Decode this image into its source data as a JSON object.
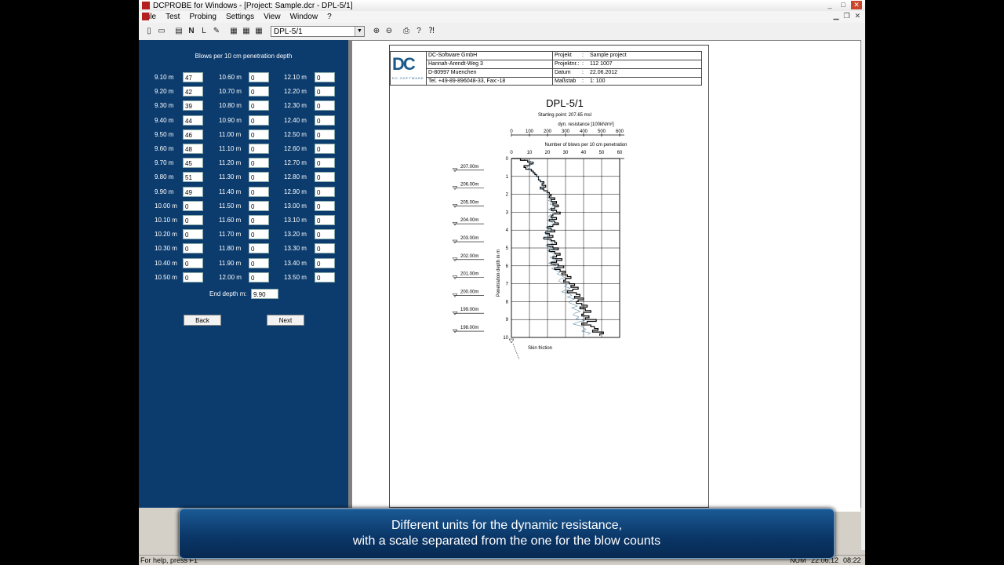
{
  "window": {
    "title": "DCPROBE for Windows - [Project: Sample.dcr - DPL-5/1]",
    "min": "_",
    "max": "□",
    "close": "✕"
  },
  "menu": [
    "File",
    "Test",
    "Probing",
    "Settings",
    "View",
    "Window",
    "?"
  ],
  "toolbar": {
    "combo_value": "DPL-5/1"
  },
  "input_panel": {
    "title": "Blows per 10 cm penetration depth",
    "col1": [
      {
        "depth": "9.10 m",
        "value": "47"
      },
      {
        "depth": "9.20 m",
        "value": "42"
      },
      {
        "depth": "9.30 m",
        "value": "39"
      },
      {
        "depth": "9.40 m",
        "value": "44"
      },
      {
        "depth": "9.50 m",
        "value": "46"
      },
      {
        "depth": "9.60 m",
        "value": "48"
      },
      {
        "depth": "9.70 m",
        "value": "45"
      },
      {
        "depth": "9.80 m",
        "value": "51"
      },
      {
        "depth": "9.90 m",
        "value": "49"
      },
      {
        "depth": "10.00 m",
        "value": "0"
      },
      {
        "depth": "10.10 m",
        "value": "0"
      },
      {
        "depth": "10.20 m",
        "value": "0"
      },
      {
        "depth": "10.30 m",
        "value": "0"
      },
      {
        "depth": "10.40 m",
        "value": "0"
      },
      {
        "depth": "10.50 m",
        "value": "0"
      }
    ],
    "col2": [
      {
        "depth": "10.60 m",
        "value": "0"
      },
      {
        "depth": "10.70 m",
        "value": "0"
      },
      {
        "depth": "10.80 m",
        "value": "0"
      },
      {
        "depth": "10.90 m",
        "value": "0"
      },
      {
        "depth": "11.00 m",
        "value": "0"
      },
      {
        "depth": "11.10 m",
        "value": "0"
      },
      {
        "depth": "11.20 m",
        "value": "0"
      },
      {
        "depth": "11.30 m",
        "value": "0"
      },
      {
        "depth": "11.40 m",
        "value": "0"
      },
      {
        "depth": "11.50 m",
        "value": "0"
      },
      {
        "depth": "11.60 m",
        "value": "0"
      },
      {
        "depth": "11.70 m",
        "value": "0"
      },
      {
        "depth": "11.80 m",
        "value": "0"
      },
      {
        "depth": "11.90 m",
        "value": "0"
      },
      {
        "depth": "12.00 m",
        "value": "0"
      }
    ],
    "col3": [
      {
        "depth": "12.10 m",
        "value": "0"
      },
      {
        "depth": "12.20 m",
        "value": "0"
      },
      {
        "depth": "12.30 m",
        "value": "0"
      },
      {
        "depth": "12.40 m",
        "value": "0"
      },
      {
        "depth": "12.50 m",
        "value": "0"
      },
      {
        "depth": "12.60 m",
        "value": "0"
      },
      {
        "depth": "12.70 m",
        "value": "0"
      },
      {
        "depth": "12.80 m",
        "value": "0"
      },
      {
        "depth": "12.90 m",
        "value": "0"
      },
      {
        "depth": "13.00 m",
        "value": "0"
      },
      {
        "depth": "13.10 m",
        "value": "0"
      },
      {
        "depth": "13.20 m",
        "value": "0"
      },
      {
        "depth": "13.30 m",
        "value": "0"
      },
      {
        "depth": "13.40 m",
        "value": "0"
      },
      {
        "depth": "13.50 m",
        "value": "0"
      }
    ],
    "end_depth_label": "End depth m:",
    "end_depth_value": "9.90",
    "back_label": "Back",
    "next_label": "Next"
  },
  "report_header": {
    "logo_text": "DC",
    "logo_sub": "DC-SOFTWARE",
    "company": "DC-Software GmbH",
    "street": "Hannah-Arendt-Weg 3",
    "city": "D-80997 Muenchen",
    "phone": "Tel. +49-89-896048-33, Fax:-18",
    "labels": [
      "Projekt",
      "Projektnr.:",
      "Datum",
      "Maßstab"
    ],
    "seps": [
      ":",
      ":",
      ":",
      ":"
    ],
    "values": [
      "Sample project",
      "112 1007",
      "22.06.2012",
      "1: 100"
    ]
  },
  "chart_data": {
    "type": "line",
    "title": "DPL-5/1",
    "subtitle": "Starting point: 207.65 msl",
    "x_top_label": "dyn. resistance [100kN/m²]",
    "x_top_ticks": [
      "0",
      "100",
      "200",
      "300",
      "400",
      "500",
      "600"
    ],
    "x_label": "Number of blows per 10 cm penetration",
    "x_ticks": [
      "0",
      "10",
      "20",
      "30",
      "40",
      "50",
      "60"
    ],
    "xlim": [
      0,
      60
    ],
    "ylabel": "Penetration depth in m",
    "y_ticks": [
      "0",
      "1",
      "2",
      "3",
      "4",
      "5",
      "6",
      "7",
      "8",
      "9",
      "10"
    ],
    "ylim": [
      0,
      10
    ],
    "elevation_levels": [
      "207.00m",
      "206.00m",
      "205.00m",
      "204.00m",
      "203.00m",
      "202.00m",
      "201.00m",
      "200.00m",
      "199.00m",
      "198.00m"
    ],
    "skin_friction_label": "Skin friction",
    "series": [
      {
        "values": [
          5,
          9,
          12,
          10,
          7,
          8,
          11,
          12,
          13,
          14,
          15,
          15,
          16,
          18,
          17,
          19,
          16,
          18,
          20,
          21,
          22,
          21,
          24,
          22,
          25,
          23,
          26,
          24,
          22,
          25,
          27,
          23,
          22,
          25,
          21,
          24,
          26,
          23,
          20,
          22,
          24,
          19,
          21,
          23,
          18,
          22,
          24,
          25,
          20,
          23,
          26,
          21,
          24,
          27,
          25,
          23,
          28,
          25,
          22,
          26,
          29,
          24,
          27,
          30,
          28,
          31,
          33,
          30,
          29,
          32,
          35,
          33,
          37,
          34,
          31,
          36,
          38,
          35,
          40,
          37,
          36,
          39,
          42,
          38,
          41,
          44,
          40,
          39,
          43,
          41,
          47,
          42,
          39,
          44,
          46,
          48,
          45,
          51,
          49
        ]
      }
    ]
  },
  "status": {
    "help": "For help, press F1",
    "num": "NUM",
    "date": "22.06.12",
    "time": "08:22"
  },
  "caption": {
    "line1": "Different units for the dynamic resistance,",
    "line2": "with a scale separated from the one for the blow counts"
  }
}
